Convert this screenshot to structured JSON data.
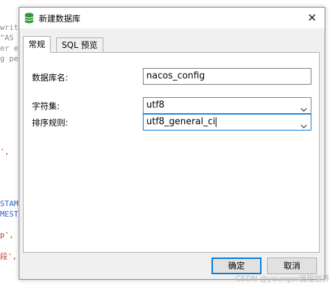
{
  "background_code": {
    "lines": [
      {
        "text": "writ",
        "cls": "c-gray"
      },
      {
        "text": " \"AS",
        "cls": "c-gray"
      },
      {
        "text": "er e",
        "cls": "c-gray"
      },
      {
        "text": "g pe",
        "cls": "c-gray"
      },
      {
        "text": "',",
        "cls": "c-red"
      },
      {
        "text": "STAM",
        "cls": "c-blue"
      },
      {
        "text": "MEST",
        "cls": "c-blue"
      },
      {
        "text": "p',",
        "cls": "c-red"
      },
      {
        "text": "段',",
        "cls": "c-red"
      }
    ]
  },
  "dialog": {
    "title": "新建数据库",
    "icon": "database-icon",
    "close_glyph": "✕"
  },
  "tabs": [
    {
      "label": "常规",
      "active": true
    },
    {
      "label": "SQL 预览",
      "active": false
    }
  ],
  "form": {
    "db_name_label": "数据库名:",
    "db_name_value": "nacos_config",
    "charset_label": "字符集:",
    "charset_value": "utf8",
    "collation_label": "排序规则:",
    "collation_value": "utf8_general_ci"
  },
  "buttons": {
    "ok": "确定",
    "cancel": "取消"
  },
  "watermark": "CSDN @younger编程世界",
  "colors": {
    "accent": "#0078d7",
    "db_icon": "#2e9a3a"
  }
}
